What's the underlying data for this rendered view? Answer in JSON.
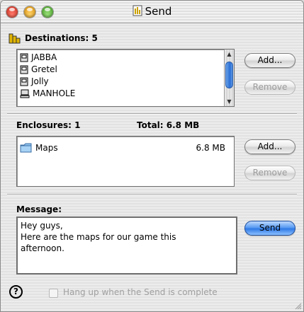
{
  "window": {
    "title": "Send"
  },
  "destinations": {
    "label": "Destinations: 5",
    "items": [
      {
        "name": "JABBA",
        "icon": "server-icon"
      },
      {
        "name": "Gretel",
        "icon": "server-icon"
      },
      {
        "name": "Jolly",
        "icon": "server-icon"
      },
      {
        "name": "MANHOLE",
        "icon": "computer-icon"
      }
    ],
    "add_label": "Add...",
    "remove_label": "Remove"
  },
  "enclosures": {
    "label": "Enclosures: 1",
    "total_label": "Total: 6.8 MB",
    "items": [
      {
        "name": "Maps",
        "size": "6.8 MB",
        "icon": "folder-icon"
      }
    ],
    "add_label": "Add...",
    "remove_label": "Remove"
  },
  "message": {
    "label": "Message:",
    "lines": [
      "Hey guys,",
      "Here are the maps for our game this",
      "afternoon."
    ]
  },
  "send_label": "Send",
  "help_label": "?",
  "hangup": {
    "label": "Hang up when the Send is complete",
    "checked": false
  },
  "colors": {
    "accent": "#2f7ae6",
    "disabled_text": "#9d9d9d"
  }
}
